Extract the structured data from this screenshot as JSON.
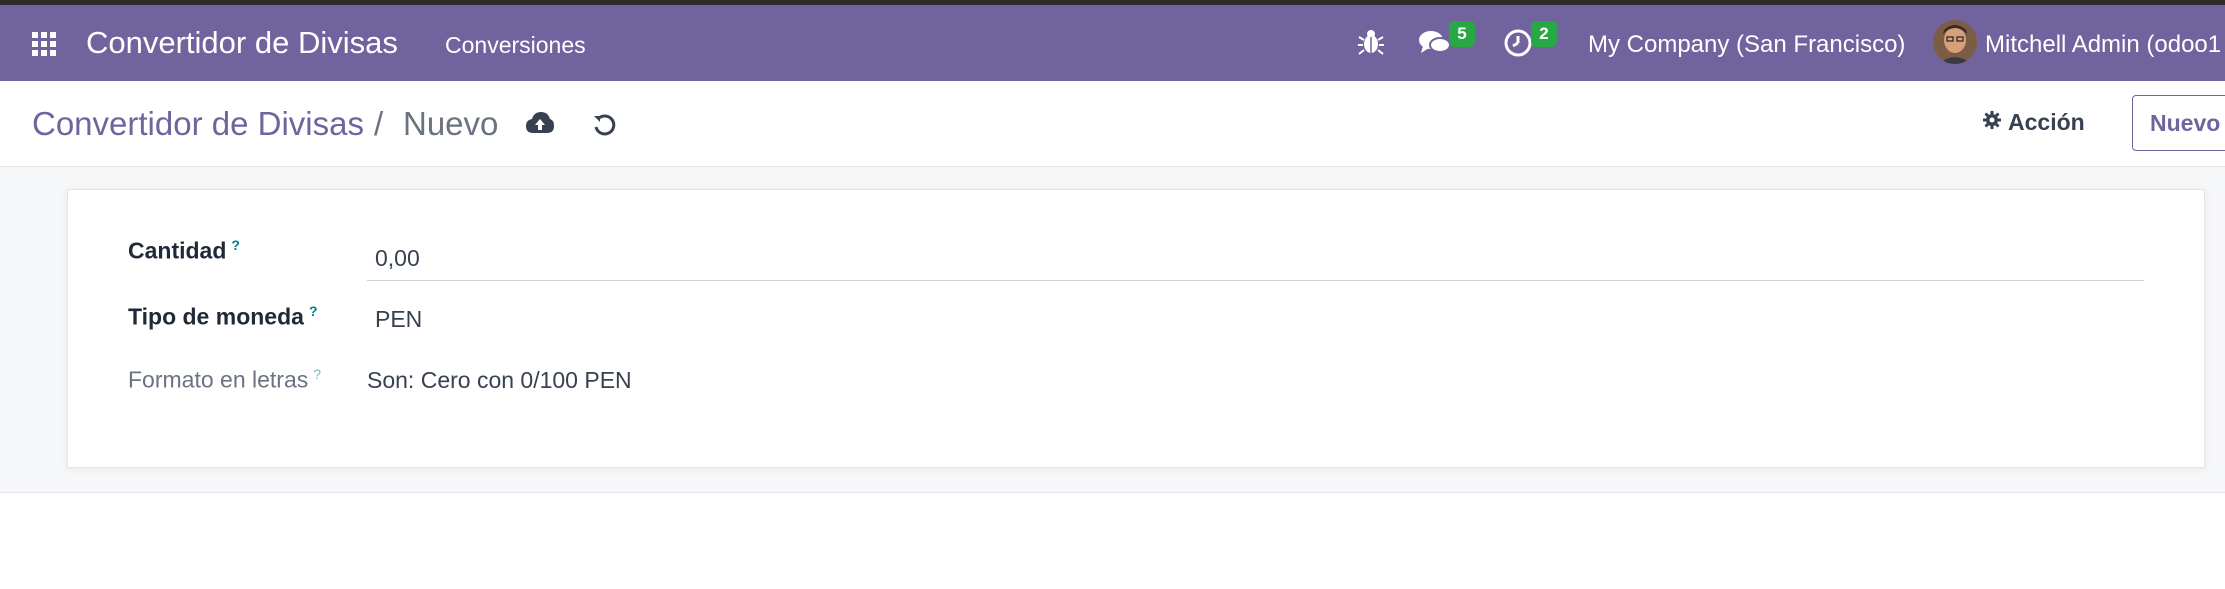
{
  "navbar": {
    "brand": "Convertidor de Divisas",
    "menu_item": "Conversiones",
    "messages_count": "5",
    "activities_count": "2",
    "company": "My Company (San Francisco)",
    "user": "Mitchell Admin (odoo1"
  },
  "control_panel": {
    "breadcrumb_root": "Convertidor de Divisas",
    "breadcrumb_separator": "/",
    "breadcrumb_current": "Nuevo",
    "action_label": "Acción",
    "new_label": "Nuevo"
  },
  "form": {
    "fields": {
      "cantidad": {
        "label": "Cantidad",
        "help": "?",
        "value": "0,00"
      },
      "tipo_moneda": {
        "label": "Tipo de moneda",
        "help": "?",
        "value": "PEN"
      },
      "formato_letras": {
        "label": "Formato en letras",
        "help": "?",
        "value": "Son: Cero con 0/100 PEN"
      }
    }
  },
  "colors": {
    "navbar_bg": "#71639e",
    "brand_accent": "#71639e",
    "badge_green": "#28a745",
    "help_teal": "#017e84"
  },
  "icons": [
    "apps-grid-icon",
    "bug-icon",
    "chat-icon",
    "clock-icon",
    "avatar",
    "cloud-upload-icon",
    "undo-icon",
    "gear-icon"
  ]
}
